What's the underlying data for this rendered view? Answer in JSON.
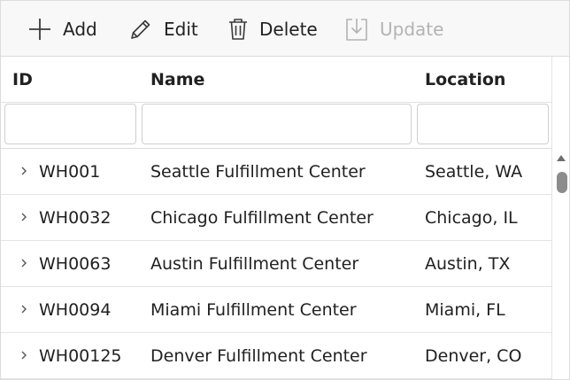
{
  "toolbar": {
    "add": {
      "label": "Add",
      "icon": "plus-icon"
    },
    "edit": {
      "label": "Edit",
      "icon": "pencil-icon"
    },
    "delete": {
      "label": "Delete",
      "icon": "trash-icon"
    },
    "update": {
      "label": "Update",
      "icon": "save-icon",
      "disabled": true
    }
  },
  "columns": {
    "id": "ID",
    "name": "Name",
    "location": "Location"
  },
  "filters": {
    "id": "",
    "name": "",
    "location": ""
  },
  "rows": [
    {
      "id": "WH001",
      "name": "Seattle Fulfillment Center",
      "location": "Seattle, WA"
    },
    {
      "id": "WH0032",
      "name": "Chicago Fulfillment Center",
      "location": "Chicago, IL"
    },
    {
      "id": "WH0063",
      "name": "Austin Fulfillment Center",
      "location": "Austin, TX"
    },
    {
      "id": "WH0094",
      "name": "Miami Fulfillment Center",
      "location": "Miami, FL"
    },
    {
      "id": "WH00125",
      "name": "Denver Fulfillment Center",
      "location": "Denver, CO"
    }
  ],
  "colors": {
    "toolbar_bg": "#f8f8f8",
    "text": "#212121",
    "disabled_text": "#b3b3b3",
    "border": "#dcdcdc",
    "scroll_thumb": "#8c8c8c"
  }
}
